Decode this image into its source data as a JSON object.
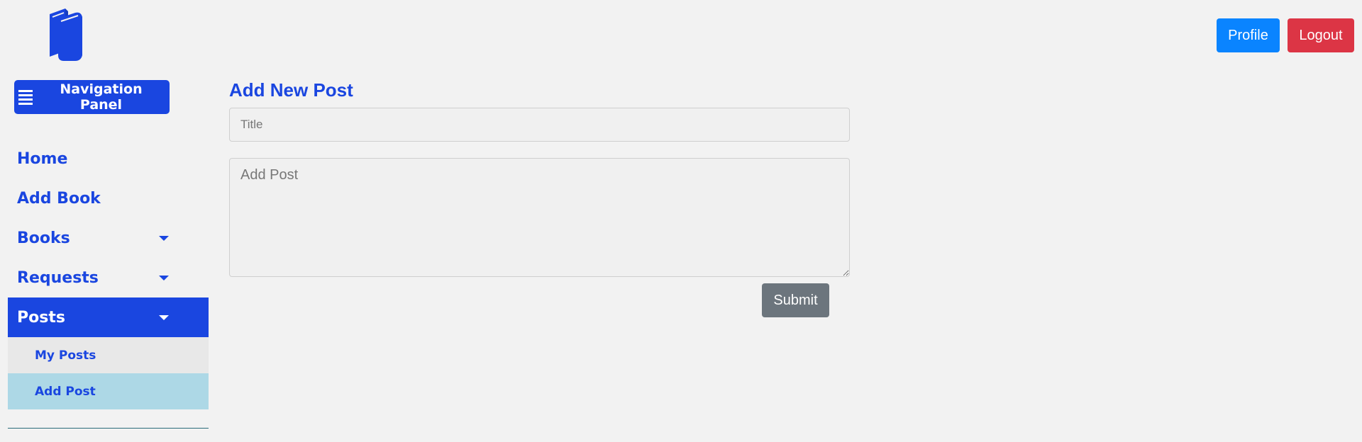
{
  "header": {
    "logo_icon": "books-icon",
    "profile_label": "Profile",
    "logout_label": "Logout"
  },
  "sidebar": {
    "toggle_label": "Navigation Panel",
    "toggle_icon": "menu-icon",
    "items": [
      {
        "label": "Home",
        "has_dropdown": false
      },
      {
        "label": "Add Book",
        "has_dropdown": false
      },
      {
        "label": "Books",
        "has_dropdown": true
      },
      {
        "label": "Requests",
        "has_dropdown": true
      },
      {
        "label": "Posts",
        "has_dropdown": true,
        "active": true
      }
    ],
    "subitems": [
      {
        "label": "My Posts"
      },
      {
        "label": "Add Post",
        "selected": true
      }
    ]
  },
  "main": {
    "heading": "Add New Post",
    "title_placeholder": "Title",
    "post_placeholder": "Add Post",
    "submit_label": "Submit"
  },
  "colors": {
    "brand_blue": "#1a46e0",
    "profile_blue": "#0a84ff",
    "logout_red": "#dc3545",
    "submit_grey": "#6c757d",
    "selected_subitem": "#add8e6"
  }
}
